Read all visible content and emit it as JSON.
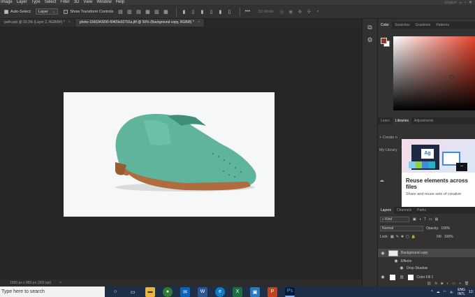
{
  "menu": [
    "Image",
    "Layer",
    "Type",
    "Select",
    "Filter",
    "3D",
    "View",
    "Window",
    "Help"
  ],
  "menu_right": "English",
  "options": {
    "auto_select_label": "Auto-Select:",
    "auto_select_value": "Layer",
    "show_transform_label": "Show Transform Controls",
    "mode_3d_label": "3D Mode:"
  },
  "tabs": [
    {
      "label": "path.psb @ 33.3% (Layer 2, RGB/8#) *"
    },
    {
      "label": "photo-1560343090-f0409e92791a.jfif @ 50% (Background copy, RGB/8) *"
    }
  ],
  "status": {
    "text": "1500 px x 883 px (300 ppi)",
    "arrow": ">"
  },
  "color_panel": {
    "tabs": [
      "Color",
      "Swatches",
      "Gradients",
      "Patterns"
    ],
    "foreground": "#8a3a2a",
    "background": "#ffffff",
    "hue": "#e8412a"
  },
  "libraries_panel": {
    "tabs": [
      "Learn",
      "Libraries",
      "Adjustments"
    ],
    "create_label": "Create n",
    "my_library_label": "My Library",
    "card_title": "Reuse elements across files",
    "card_text": "Share and reuse sets of creative"
  },
  "layers_panel": {
    "tabs": [
      "Layers",
      "Channels",
      "Paths"
    ],
    "kind_label": "Kind",
    "blend_mode": "Normal",
    "opacity_label": "Opacity:",
    "opacity_value": "100%",
    "lock_label": "Lock:",
    "fill_label": "Fill:",
    "fill_value": "100%",
    "layers": [
      {
        "name": "Background copy"
      },
      {
        "name": "Effects"
      },
      {
        "name": "Drop Shadow"
      },
      {
        "name": "Color Fill 1"
      }
    ]
  },
  "taskbar": {
    "search_placeholder": "Type here to search",
    "lang": "ENG",
    "region": "INTL",
    "time": "12:"
  }
}
